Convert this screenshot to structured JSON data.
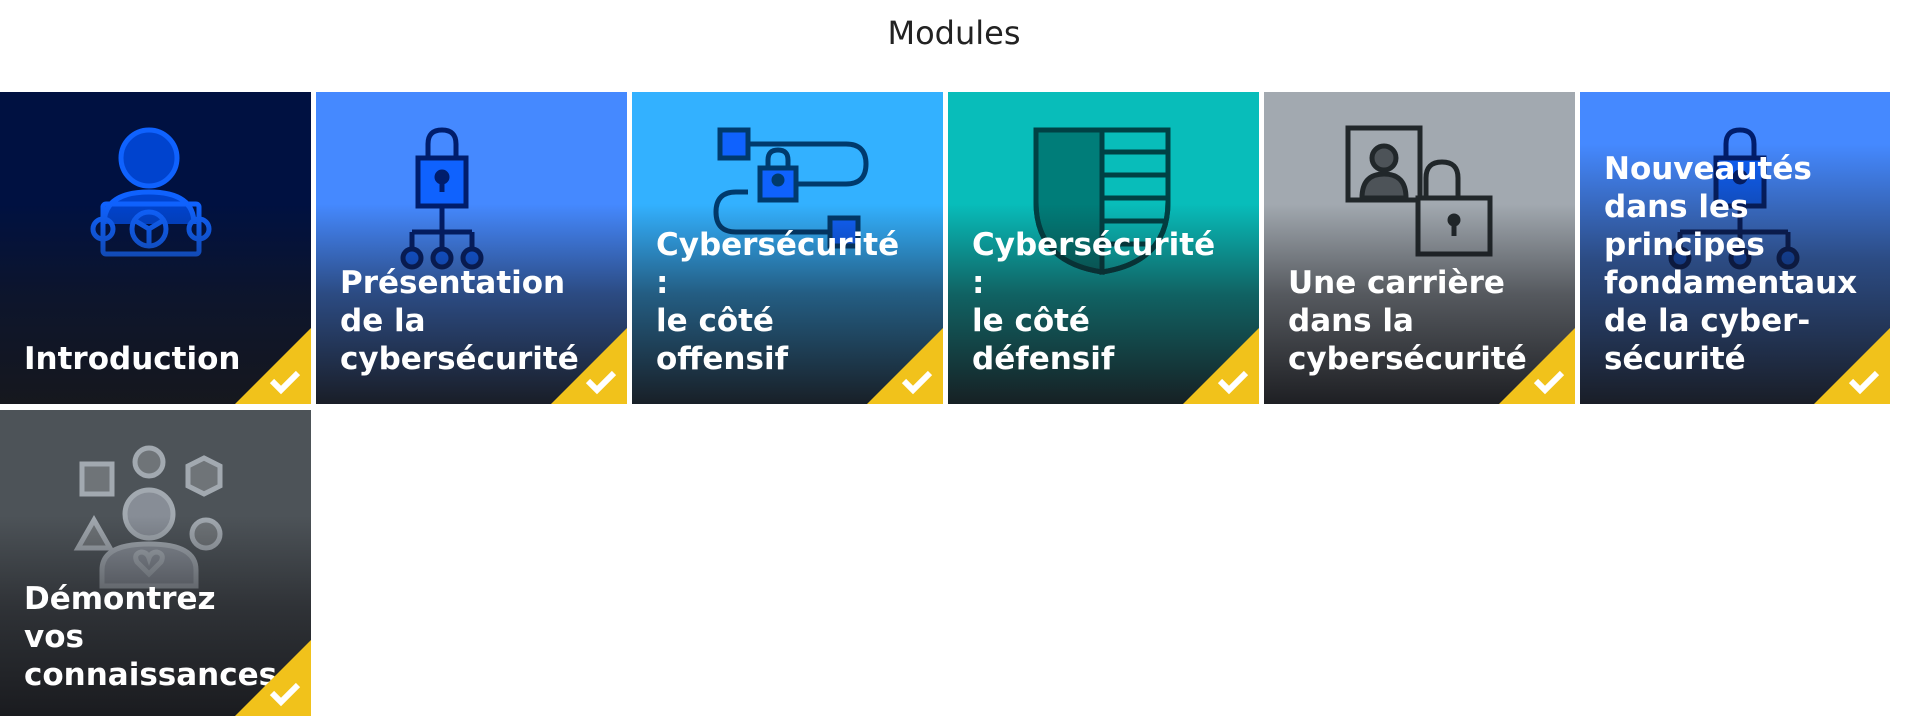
{
  "page": {
    "title": "Modules"
  },
  "colors": {
    "tile_introduction": "#001141",
    "tile_presentation": "#4589ff",
    "tile_offensive": "#33b1ff",
    "tile_defensive": "#08bdba",
    "tile_career": "#a2a9b0",
    "tile_news": "#4589ff",
    "tile_knowledge": "#4d5358",
    "completed_badge": "#f1c21b",
    "label_text": "#ffffff"
  },
  "modules": [
    {
      "label": "Introduction",
      "icon": "person-holding-sign-icon",
      "completed": true
    },
    {
      "label": "Présentation\nde la\ncybersécurité",
      "icon": "lock-network-icon",
      "completed": true
    },
    {
      "label": "Cybersécurité :\nle côté offensif",
      "icon": "lock-path-icon",
      "completed": true
    },
    {
      "label": "Cybersécurité :\nle côté défensif",
      "icon": "shield-icon",
      "completed": true
    },
    {
      "label": "Une carrière\ndans la\ncybersécurité",
      "icon": "profile-lock-icon",
      "completed": true
    },
    {
      "label": "Nouveautés\ndans les\nprincipes\nfondamentaux\nde la cyber-\nsécurité",
      "icon": "lock-network-icon",
      "completed": true
    },
    {
      "label": "Démontrez vos\nconnaissances",
      "icon": "person-shapes-icon",
      "completed": true
    }
  ]
}
